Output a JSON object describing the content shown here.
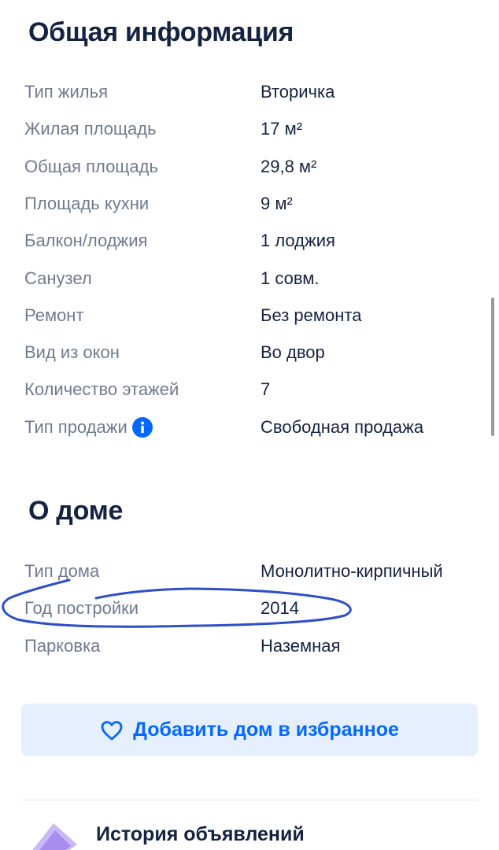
{
  "general": {
    "title": "Общая информация",
    "rows": [
      {
        "label": "Тип жилья",
        "value": "Вторичка"
      },
      {
        "label": "Жилая площадь",
        "value": "17 м²"
      },
      {
        "label": "Общая площадь",
        "value": "29,8 м²"
      },
      {
        "label": "Площадь кухни",
        "value": "9 м²"
      },
      {
        "label": "Балкон/лоджия",
        "value": "1 лоджия"
      },
      {
        "label": "Санузел",
        "value": "1 совм."
      },
      {
        "label": "Ремонт",
        "value": "Без ремонта"
      },
      {
        "label": "Вид из окон",
        "value": "Во двор"
      },
      {
        "label": "Количество этажей",
        "value": "7"
      },
      {
        "label": "Тип продажи",
        "value": "Свободная продажа",
        "icon": "info-icon"
      }
    ]
  },
  "house": {
    "title": "О доме",
    "rows": [
      {
        "label": "Тип дома",
        "value": "Монолитно-кирпичный"
      },
      {
        "label": "Год постройки",
        "value": "2014"
      },
      {
        "label": "Парковка",
        "value": "Наземная"
      }
    ]
  },
  "favorite_button": {
    "label": "Добавить дом в избранное",
    "icon": "heart-icon"
  },
  "history": {
    "title": "История объявлений"
  },
  "colors": {
    "accent": "#0468ff",
    "button_bg": "#e6effd",
    "text": "#152242",
    "muted": "#707a8f",
    "annotation": "#2f4fc9"
  }
}
